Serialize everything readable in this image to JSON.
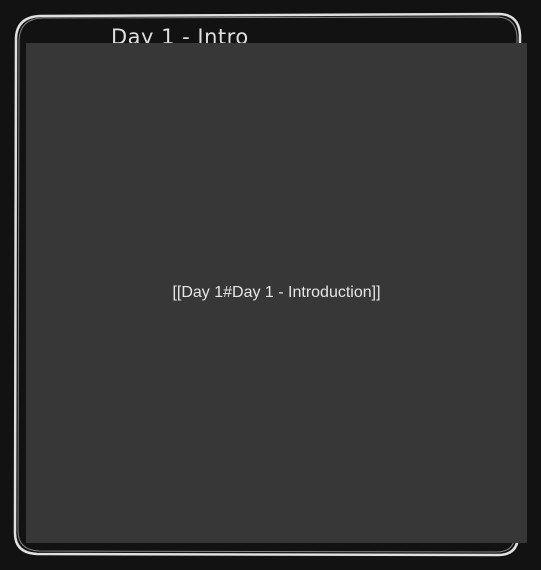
{
  "frame": {
    "title": "Day 1 - Intro"
  },
  "embed": {
    "link_text": "[[Day 1#Day 1 - Introduction]]"
  },
  "colors": {
    "background": "#121212",
    "frame_stroke": "#e0e0e0",
    "embed_fill": "#373737",
    "text": "#e6e6e6"
  }
}
